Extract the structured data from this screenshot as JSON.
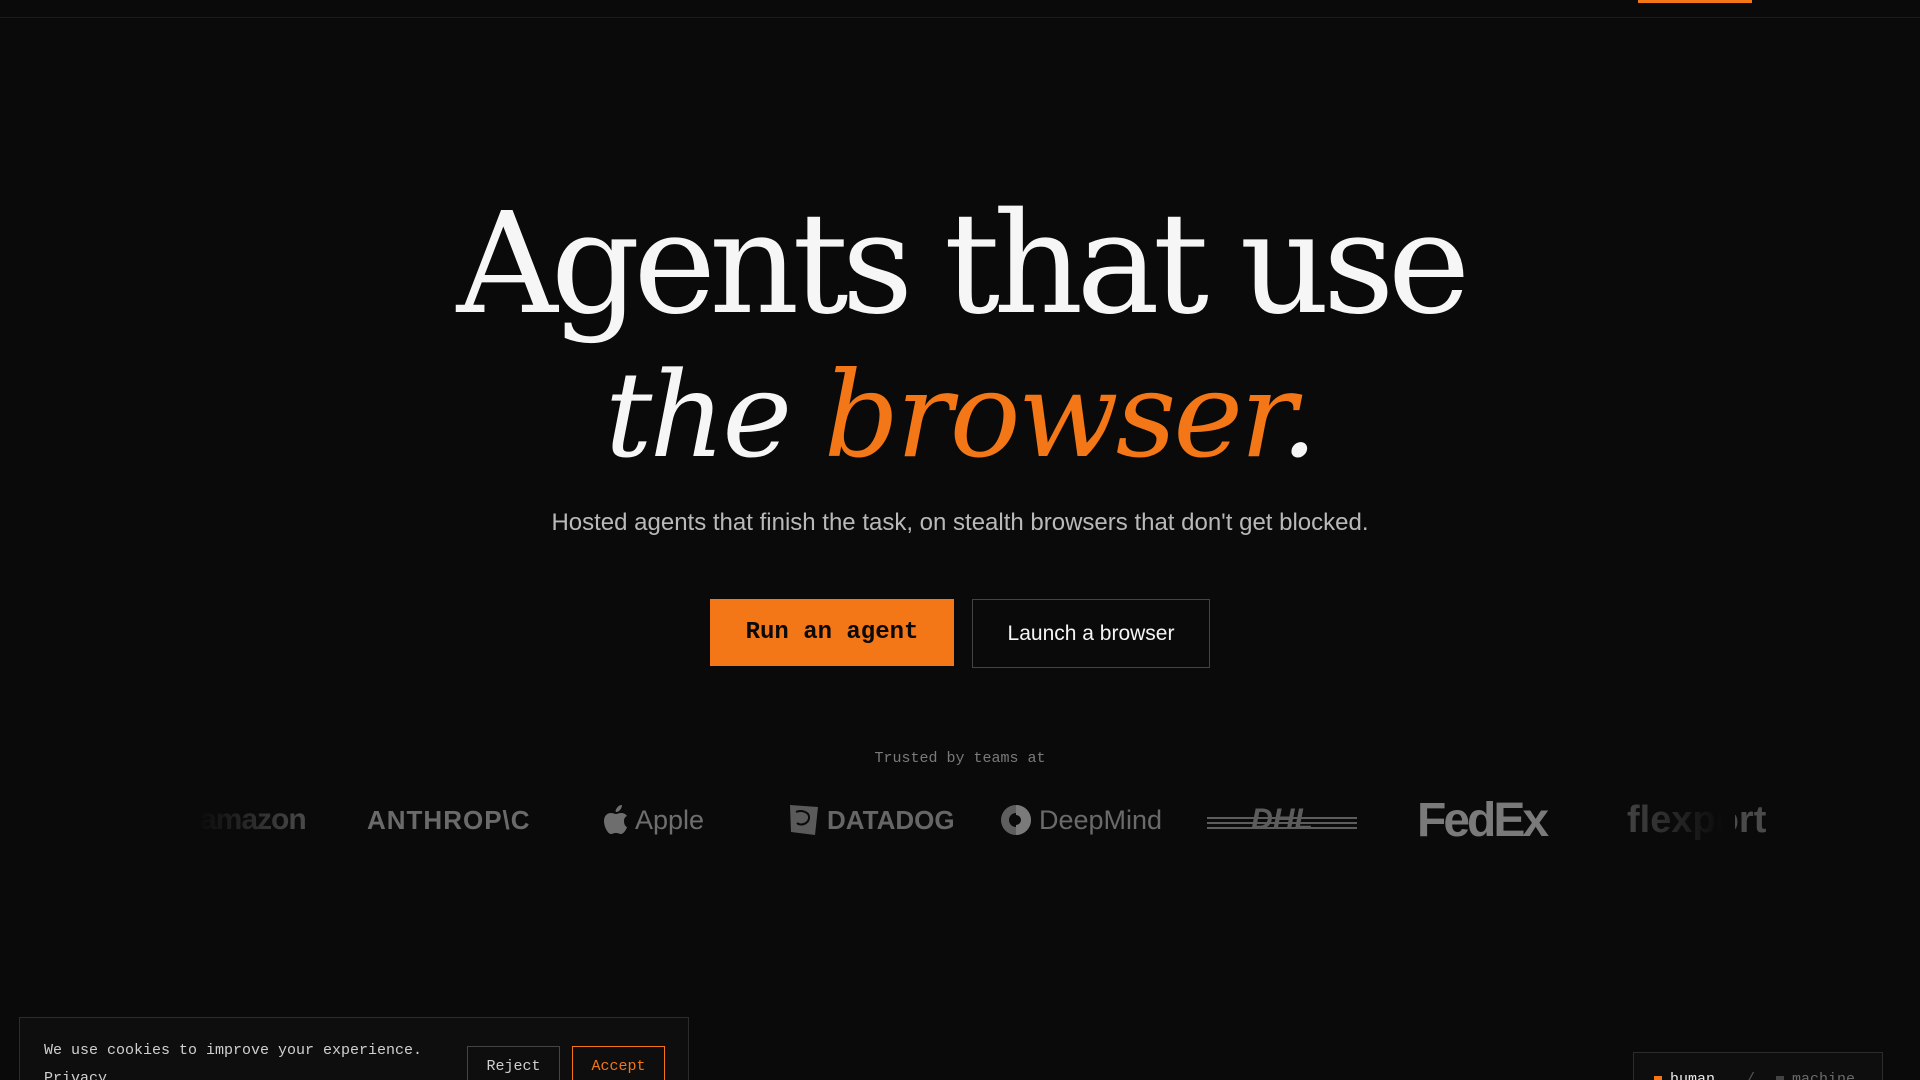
{
  "colors": {
    "background": "#0a0a0a",
    "accent": "#f37617",
    "text": "#f5f5f5",
    "muted": "#b9b9b9",
    "logo": "#6b6b6b"
  },
  "hero": {
    "line1": "Agents that use",
    "line2_prefix": "the",
    "line2_accent": "browser",
    "line2_suffix": ".",
    "subtitle": "Hosted agents that finish the task, on stealth browsers that don't get blocked."
  },
  "cta": {
    "primary_label": "Run an agent",
    "secondary_label": "Launch a browser"
  },
  "trusted": {
    "label": "Trusted by teams at",
    "logos": [
      "amazon",
      "ANTHROP\\C",
      "Apple",
      "DATADOG",
      "DeepMind",
      "DHL",
      "FedEx",
      "flexport"
    ]
  },
  "cookie": {
    "text": "We use cookies to improve your experience.",
    "privacy_label": "Privacy",
    "reject_label": "Reject",
    "accept_label": "Accept"
  },
  "mode_toggle": {
    "human_label": "human",
    "separator": "/",
    "machine_label": "machine",
    "active": "human"
  }
}
